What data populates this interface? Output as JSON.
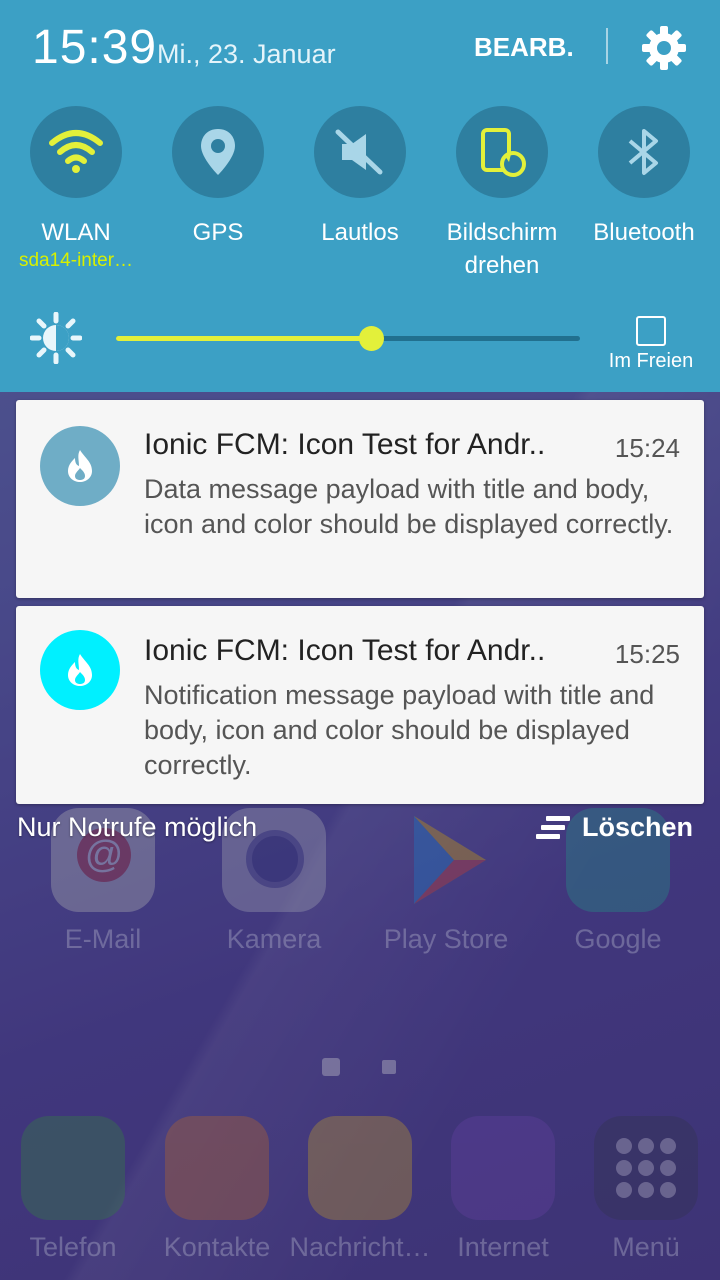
{
  "status": {
    "time": "15:39",
    "date": "Mi., 23. Januar",
    "edit_label": "BEARB."
  },
  "quick_tiles": [
    {
      "label": "WLAN",
      "sub": "sda14-inter…",
      "icon": "wifi-icon"
    },
    {
      "label": "GPS",
      "sub": "",
      "icon": "location-pin-icon"
    },
    {
      "label": "Lautlos",
      "sub": "",
      "icon": "mute-icon"
    },
    {
      "label": "Bildschirm drehen",
      "sub": "",
      "icon": "rotate-screen-icon"
    },
    {
      "label": "Bluetooth",
      "sub": "",
      "icon": "bluetooth-icon"
    }
  ],
  "brightness": {
    "level": 0.55,
    "outdoor_label": "Im Freien"
  },
  "notifications": [
    {
      "title": "Ionic FCM: Icon Test for Andr..",
      "time": "15:24",
      "body": "Data message payload with title and body, icon and color should be displayed correctly.",
      "icon_color": "#6fadc6"
    },
    {
      "title": "Ionic FCM: Icon Test for Andr..",
      "time": "15:25",
      "body": "Notification message payload with title and body, icon and color should be displayed correctly.",
      "icon_color": "#00f0ff"
    }
  ],
  "shade_footer": {
    "emergency_label": "Nur Notrufe möglich",
    "clear_label": "Löschen"
  },
  "home_apps": [
    {
      "label": "E-Mail"
    },
    {
      "label": "Kamera"
    },
    {
      "label": "Play Store"
    },
    {
      "label": "Google"
    }
  ],
  "dock_apps": [
    {
      "label": "Telefon"
    },
    {
      "label": "Kontakte"
    },
    {
      "label": "Nachricht…"
    },
    {
      "label": "Internet"
    },
    {
      "label": "Menü"
    }
  ],
  "colors": {
    "panel": "#3ca0c5",
    "tile_circle": "#2e7fa0",
    "accent": "#e3f03a"
  }
}
